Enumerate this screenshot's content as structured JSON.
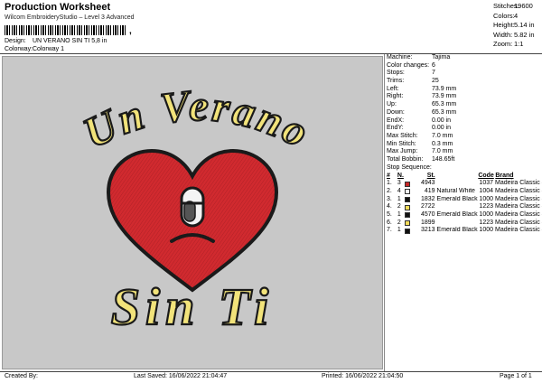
{
  "header": {
    "title": "Production Worksheet",
    "subtitle": "Wilcom EmbroideryStudio – Level 3 Advanced",
    "barcode_tail": ","
  },
  "meta": [
    {
      "label": "Design:",
      "value": "UN VERANO SIN TI 5,8 in"
    },
    {
      "label": "Colorway:",
      "value": "Colorway 1"
    }
  ],
  "stats": [
    {
      "label": "Stitches:",
      "value": "19600"
    },
    {
      "label": "Colors:",
      "value": "4"
    },
    {
      "label": "Height:",
      "value": "5.14 in"
    },
    {
      "label": "Width:",
      "value": "5.82 in"
    },
    {
      "label": "Zoom:",
      "value": "1:1"
    }
  ],
  "properties": [
    {
      "label": "Machine:",
      "value": "Tajima"
    },
    {
      "label": "Color changes:",
      "value": "6"
    },
    {
      "label": "Stops:",
      "value": "7"
    },
    {
      "label": "Trims:",
      "value": "25"
    },
    {
      "label": "Left:",
      "value": "73.9 mm"
    },
    {
      "label": "Right:",
      "value": "73.9 mm"
    },
    {
      "label": "Up:",
      "value": "65.3 mm"
    },
    {
      "label": "Down:",
      "value": "65.3 mm"
    },
    {
      "label": "EndX:",
      "value": "0.00 in"
    },
    {
      "label": "EndY:",
      "value": "0.00 in"
    },
    {
      "label": "Max Stitch:",
      "value": "7.0 mm"
    },
    {
      "label": "Min Stitch:",
      "value": "0.3 mm"
    },
    {
      "label": "Max Jump:",
      "value": "7.0 mm"
    },
    {
      "label": "Total Bobbin:",
      "value": "148.65ft"
    }
  ],
  "sequence": {
    "label": "Stop Sequence:",
    "headers": {
      "index": "#",
      "n": "N.",
      "st": "St.",
      "code": "Code",
      "brand": "Brand"
    },
    "rows": [
      {
        "idx": "1.",
        "n": "3",
        "color": "#c62828",
        "st": "4943",
        "name": "",
        "code": "1037",
        "brand": "Madeira Classic 40"
      },
      {
        "idx": "2.",
        "n": "4",
        "color": "#f4f4f4",
        "st": "419",
        "name": "Natural White",
        "code": "1004",
        "brand": "Madeira Classic 40"
      },
      {
        "idx": "3.",
        "n": "1",
        "color": "#111111",
        "st": "1832",
        "name": "Emerald Black",
        "code": "1000",
        "brand": "Madeira Classic 40"
      },
      {
        "idx": "4.",
        "n": "2",
        "color": "#f3dc5a",
        "st": "2722",
        "name": "",
        "code": "1223",
        "brand": "Madeira Classic 40"
      },
      {
        "idx": "5.",
        "n": "1",
        "color": "#111111",
        "st": "4570",
        "name": "Emerald Black",
        "code": "1000",
        "brand": "Madeira Classic 40"
      },
      {
        "idx": "6.",
        "n": "2",
        "color": "#f3dc5a",
        "st": "1899",
        "name": "",
        "code": "1223",
        "brand": "Madeira Classic 40"
      },
      {
        "idx": "7.",
        "n": "1",
        "color": "#111111",
        "st": "3213",
        "name": "Emerald Black",
        "code": "1000",
        "brand": "Madeira Classic 40"
      }
    ]
  },
  "design_text": {
    "line1": "Un Verano",
    "line2": "Sin Ti"
  },
  "footer": {
    "created": "Created By:",
    "saved": "Last Saved: 16/06/2022 21:04:47",
    "printed": "Printed: 16/06/2022 21:04:50",
    "page": "Page 1 of 1"
  }
}
